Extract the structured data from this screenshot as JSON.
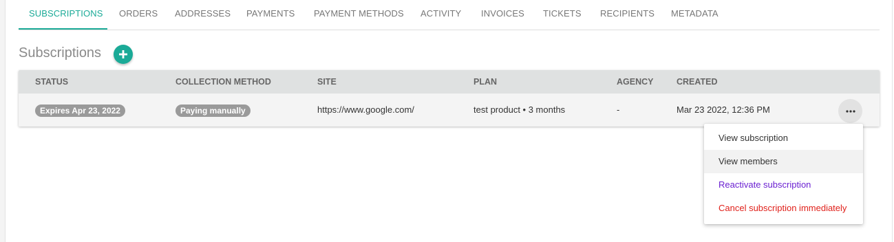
{
  "tabs": [
    {
      "label": "SUBSCRIPTIONS",
      "active": true
    },
    {
      "label": "ORDERS"
    },
    {
      "label": "ADDRESSES"
    },
    {
      "label": "PAYMENTS"
    },
    {
      "label": "PAYMENT METHODS"
    },
    {
      "label": "ACTIVITY"
    },
    {
      "label": "INVOICES"
    },
    {
      "label": "TICKETS"
    },
    {
      "label": "RECIPIENTS"
    },
    {
      "label": "METADATA"
    }
  ],
  "section": {
    "title": "Subscriptions",
    "add_icon": "plus-icon"
  },
  "table": {
    "columns": [
      "STATUS",
      "COLLECTION METHOD",
      "SITE",
      "PLAN",
      "AGENCY",
      "CREATED"
    ],
    "rows": [
      {
        "status": "Expires Apr 23, 2022",
        "collection_method": "Paying manually",
        "site": "https://www.google.com/",
        "plan": "test product • 3 months",
        "agency": "-",
        "created": "Mar 23 2022, 12:36 PM",
        "actions_icon": "more-horizontal-icon"
      }
    ]
  },
  "menu": {
    "items": [
      {
        "label": "View subscription"
      },
      {
        "label": "View members",
        "hovered": true
      },
      {
        "label": "Reactivate subscription",
        "color": "#6a1fd1"
      },
      {
        "label": "Cancel subscription immediately",
        "color": "#e0201a"
      }
    ]
  },
  "colors": {
    "accent": "#1aaa97",
    "badge": "#9a9a9a",
    "header_bg": "#dfe1e1"
  }
}
